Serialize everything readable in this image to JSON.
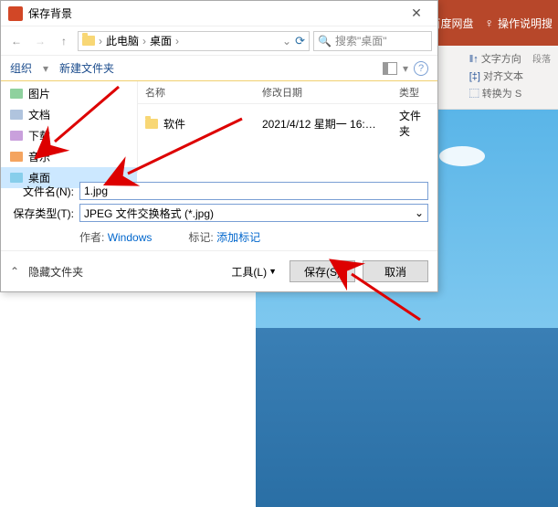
{
  "dialog": {
    "title": "保存背景",
    "breadcrumb": {
      "pc": "此电脑",
      "desktop": "桌面"
    },
    "search_placeholder": "搜索\"桌面\"",
    "toolbar": {
      "organize": "组织",
      "new_folder": "新建文件夹"
    },
    "sidebar": {
      "items": [
        {
          "label": "图片"
        },
        {
          "label": "文档"
        },
        {
          "label": "下载"
        },
        {
          "label": "音乐"
        },
        {
          "label": "桌面"
        }
      ]
    },
    "columns": {
      "name": "名称",
      "date": "修改日期",
      "type": "类型"
    },
    "files": [
      {
        "name": "软件",
        "date": "2021/4/12 星期一 16:…",
        "type": "文件夹"
      }
    ],
    "filename_label": "文件名(N):",
    "filename_value": "1.jpg",
    "filetype_label": "保存类型(T):",
    "filetype_value": "JPEG 文件交换格式 (*.jpg)",
    "author_label": "作者:",
    "author_value": "Windows",
    "tags_label": "标记:",
    "tags_value": "添加标记",
    "hide_folders": "隐藏文件夹",
    "tools_label": "工具(L)",
    "save_button": "保存(S)",
    "cancel_button": "取消"
  },
  "ppt": {
    "baidu": "百度网盘",
    "help": "操作说明搜",
    "textdir": "文字方向",
    "align": "对齐文本",
    "convert": "转换为 S",
    "para": "段落"
  }
}
